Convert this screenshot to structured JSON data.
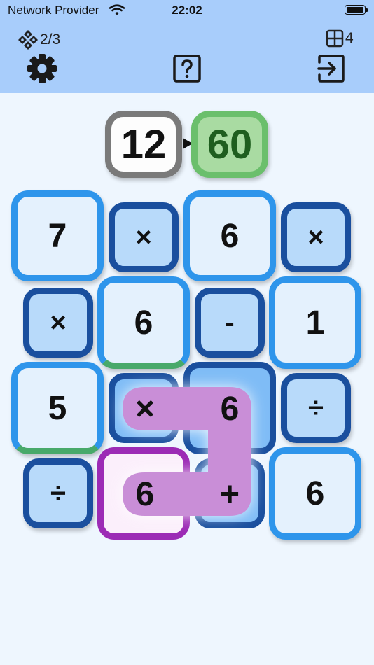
{
  "status": {
    "carrier": "Network Provider",
    "time": "22:02"
  },
  "toolbar": {
    "progress": "2/3",
    "grid_count": "4",
    "settings_icon": "gear-icon",
    "help_icon": "question-icon",
    "exit_icon": "exit-icon",
    "progress_icon": "diamond-dots-icon",
    "grid_icon": "grid-icon"
  },
  "goal": {
    "current": "12",
    "target": "60"
  },
  "board": {
    "r1c1": "7",
    "r1c2": "×",
    "r1c3": "6",
    "r1c4": "×",
    "r2c1": "×",
    "r2c2": "6",
    "r2c3": "-",
    "r2c4": "1",
    "r3c1": "5",
    "r3c4": "÷",
    "r4c1": "÷",
    "r4c4": "6"
  },
  "selection": {
    "a": "×",
    "b": "6",
    "c": "6",
    "d": "+"
  },
  "colors": {
    "bar": "#a8cdfb",
    "number_border": "#2e95eb",
    "number_fill": "#e4f1fd",
    "operator_border": "#1a4f9e",
    "operator_fill": "#b8dafa",
    "path_fill": "#c98ed7",
    "selected_border": "#9c2bb5",
    "target_border": "#6bbf6c",
    "target_fill": "#a9dba2",
    "target_text": "#1f5e1f"
  }
}
